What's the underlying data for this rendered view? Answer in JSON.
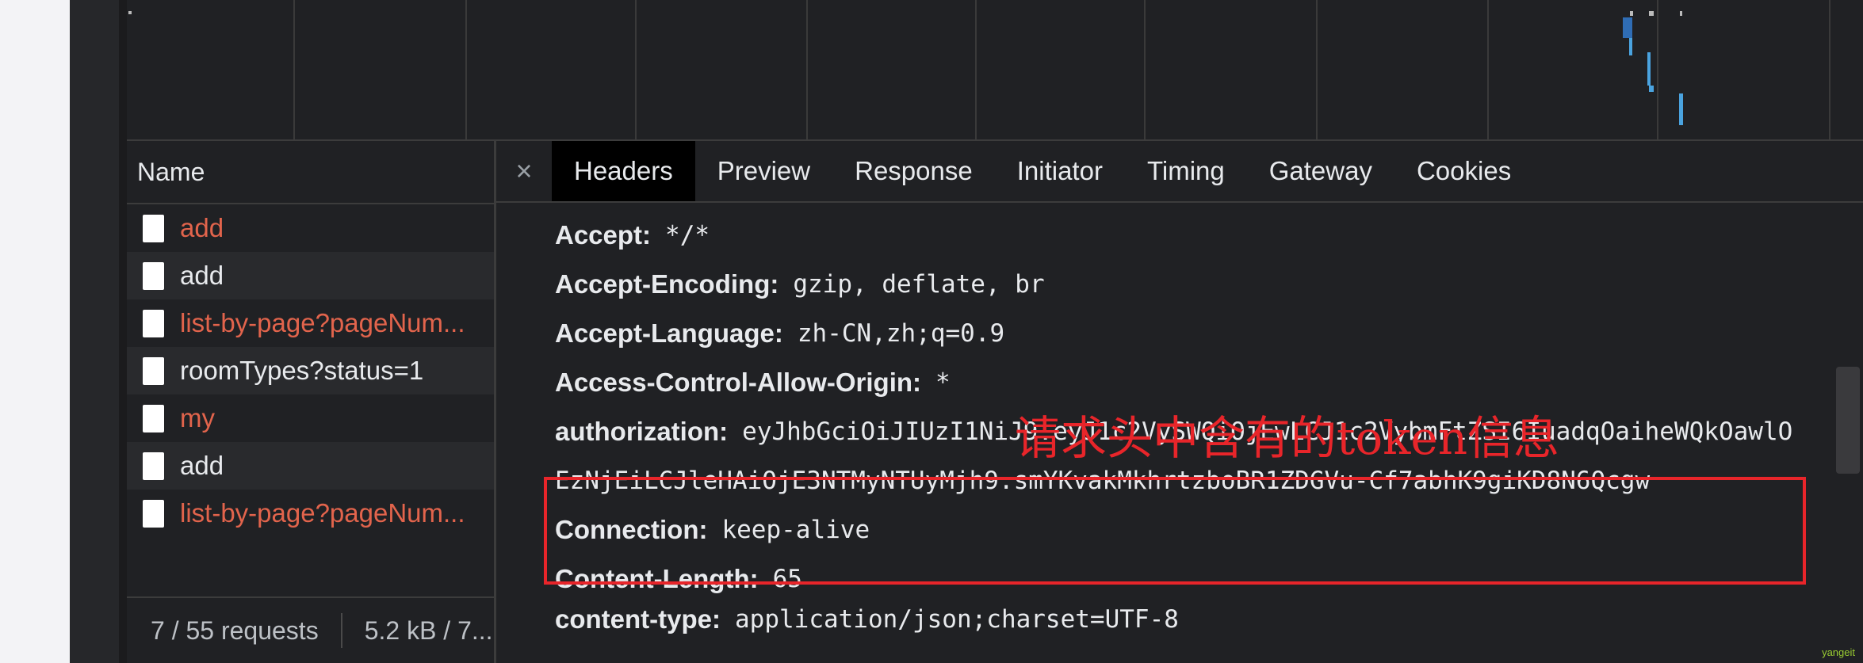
{
  "name_pane": {
    "header": "Name",
    "requests": [
      {
        "name": "add",
        "error": true
      },
      {
        "name": "add",
        "error": false
      },
      {
        "name": "list-by-page?pageNum...",
        "error": true
      },
      {
        "name": "roomTypes?status=1",
        "error": false
      },
      {
        "name": "my",
        "error": true
      },
      {
        "name": "add",
        "error": false
      },
      {
        "name": "list-by-page?pageNum...",
        "error": true
      }
    ],
    "status_count": "7 / 55 requests",
    "status_size": "5.2 kB / 7..."
  },
  "tabs": {
    "close": "×",
    "items": [
      "Headers",
      "Preview",
      "Response",
      "Initiator",
      "Timing",
      "Gateway",
      "Cookies"
    ],
    "active": "Headers"
  },
  "request_headers": [
    {
      "name": "Accept:",
      "value": "*/*"
    },
    {
      "name": "Accept-Encoding:",
      "value": "gzip, deflate, br"
    },
    {
      "name": "Accept-Language:",
      "value": "zh-CN,zh;q=0.9"
    },
    {
      "name": "Access-Control-Allow-Origin:",
      "value": "*"
    },
    {
      "name": "authorization:",
      "value": "eyJhbGciOiJIUzI1NiJ9.eyJ1c2VySWQiOjEwLCJ1c2VybmFtZSI6IuadqOaiheWQkOawlO",
      "value_cont": "EzNjEiLCJleHAiOjE3NTMyNTUyMjh9.smYKvakMkhrtzboBR1ZDGVu-Cf7abhK9giKD8N6Qcgw"
    },
    {
      "name": "Connection:",
      "value": "keep-alive"
    },
    {
      "name": "Content-Length:",
      "value": "65"
    },
    {
      "name": "content-type:",
      "value": "application/json;charset=UTF-8"
    }
  ],
  "annotation": "请求头中含有的token信息",
  "watermark": "yangeit",
  "colors": {
    "error_text": "#e2644c",
    "annotation_red": "#e8252a",
    "timeline_blue": "#4aa3df"
  }
}
